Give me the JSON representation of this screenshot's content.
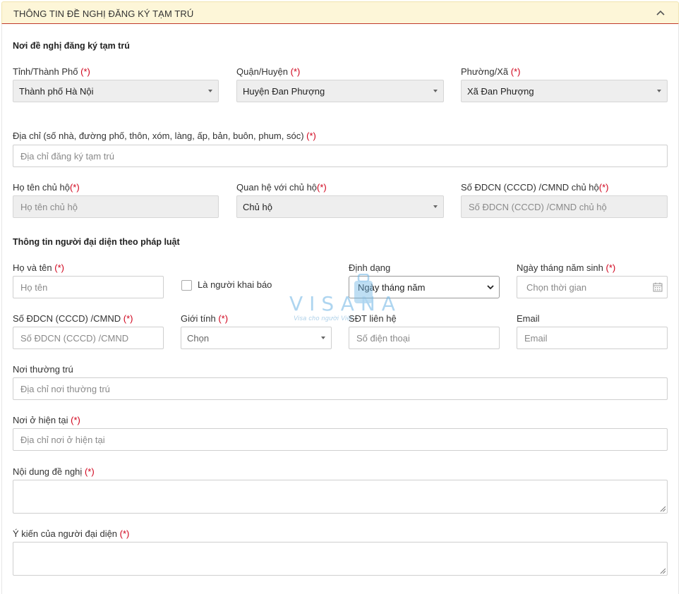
{
  "panel": {
    "title": "THÔNG TIN ĐỀ NGHỊ ĐĂNG KÝ TẠM TRÚ"
  },
  "colors": {
    "required": "#d0021b",
    "header_bg": "#fdf6d8",
    "header_border": "#c0392b",
    "watermark": "#6cb4e4"
  },
  "location_section": {
    "title": "Nơi đề nghị đăng ký tạm trú",
    "province": {
      "label": "Tỉnh/Thành Phố",
      "required_mark": "(*)",
      "value": "Thành phố Hà Nội"
    },
    "district": {
      "label": "Quận/Huyện",
      "required_mark": "(*)",
      "value": "Huyện Đan Phượng"
    },
    "ward": {
      "label": "Phường/Xã",
      "required_mark": "(*)",
      "value": "Xã Đan Phượng"
    },
    "address": {
      "label": "Địa chỉ (số nhà, đường phố, thôn, xóm, làng, ấp, bản, buôn, phum, sóc)",
      "required_mark": "(*)",
      "placeholder": "Địa chỉ đăng ký tạm trú"
    },
    "head_name": {
      "label": "Họ tên chủ hộ",
      "required_mark": "(*)",
      "placeholder": "Họ tên chủ hộ"
    },
    "relation": {
      "label": "Quan hệ với chủ hộ",
      "required_mark": "(*)",
      "value": "Chủ hộ"
    },
    "head_id": {
      "label": "Số ĐDCN (CCCD) /CMND chủ hộ",
      "required_mark": "(*)",
      "placeholder": "Số ĐDCN (CCCD) /CMND chủ hộ"
    }
  },
  "representative_section": {
    "title": "Thông tin người đại diện theo pháp luật",
    "full_name": {
      "label": "Họ và tên",
      "required_mark": "(*)",
      "placeholder": "Họ tên"
    },
    "is_declarant": {
      "label": "Là người khai báo",
      "checked": false
    },
    "format": {
      "label": "Định dạng",
      "value": "Ngày tháng năm"
    },
    "dob": {
      "label": "Ngày tháng năm sinh",
      "required_mark": "(*)",
      "placeholder": "Chọn thời gian"
    },
    "id_number": {
      "label": "Số ĐDCN (CCCD) /CMND",
      "required_mark": "(*)",
      "placeholder": "Số ĐDCN (CCCD) /CMND"
    },
    "gender": {
      "label": "Giới tính",
      "required_mark": "(*)",
      "value": "Chọn"
    },
    "phone": {
      "label": "SĐT liên hệ",
      "placeholder": "Số điện thoại"
    },
    "email": {
      "label": "Email",
      "placeholder": "Email"
    },
    "permanent_address": {
      "label": "Nơi thường trú",
      "placeholder": "Địa chỉ nơi thường trú"
    },
    "current_address": {
      "label": "Nơi ở hiện tại",
      "required_mark": "(*)",
      "placeholder": "Địa chỉ nơi ở hiện tại"
    },
    "request_content": {
      "label": "Nội dung đề nghị",
      "required_mark": "(*)"
    },
    "representative_opinion": {
      "label": "Ý kiến của người đại diện",
      "required_mark": "(*)"
    }
  },
  "watermark": {
    "brand": "VISANA",
    "tagline": "Visa cho người Việt"
  }
}
